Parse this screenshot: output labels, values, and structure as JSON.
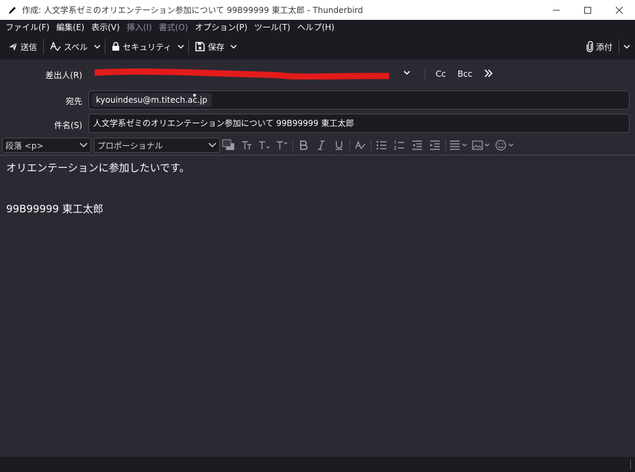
{
  "window": {
    "title": "作成: 人文学系ゼミのオリエンテーション参加について 99B99999 東工太郎 - Thunderbird",
    "controls": [
      "minimize",
      "maximize",
      "close"
    ]
  },
  "menubar": {
    "items": [
      {
        "label": "ファイル(F)",
        "enabled": true
      },
      {
        "label": "編集(E)",
        "enabled": true
      },
      {
        "label": "表示(V)",
        "enabled": true
      },
      {
        "label": "挿入(I)",
        "enabled": false
      },
      {
        "label": "書式(O)",
        "enabled": false
      },
      {
        "label": "オプション(P)",
        "enabled": true
      },
      {
        "label": "ツール(T)",
        "enabled": true
      },
      {
        "label": "ヘルプ(H)",
        "enabled": true
      }
    ]
  },
  "toolbar": {
    "send_label": "送信",
    "spell_label": "スペル",
    "security_label": "セキュリティ",
    "save_label": "保存",
    "attach_label": "添付"
  },
  "headers": {
    "from_label": "差出人(R)",
    "to_label": "宛先",
    "subject_label": "件名(S)",
    "cc_label": "Cc",
    "bcc_label": "Bcc",
    "recipient": "kyouindesu@m.titech.ac.jp",
    "subject": "人文学系ゼミのオリエンテーション参加について 99B99999 東工太郎"
  },
  "format": {
    "paragraph": "段落 <p>",
    "font": "プロポーショナル"
  },
  "body": {
    "lines": [
      "オリエンテーションに参加したいです。",
      "",
      "",
      "99B99999 東工太郎"
    ]
  },
  "colors": {
    "background": "#2b2a33",
    "toolbar": "#1c1b22",
    "text": "#fbfbfe",
    "redaction": "#e31b1b"
  }
}
